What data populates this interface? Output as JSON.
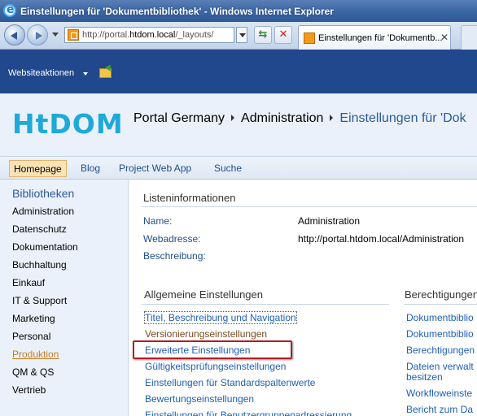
{
  "browser": {
    "window_title": "Einstellungen für 'Dokumentbibliothek' - Windows Internet Explorer",
    "address_host_prefix": "http://portal.",
    "address_host_bold": "htdom.local",
    "address_path": "/_layouts/",
    "tab_title": "Einstellungen für 'Dokumentb...",
    "tab_close": "✕",
    "refresh_glyph": "⇆",
    "stop_glyph": "✕"
  },
  "ribbon": {
    "site_actions": "Websiteaktionen"
  },
  "header": {
    "logo": "HtDOM",
    "breadcrumb": [
      "Portal Germany",
      "Administration",
      "Einstellungen für 'Dok"
    ]
  },
  "topnav": [
    {
      "label": "Homepage",
      "active": true
    },
    {
      "label": "Blog"
    },
    {
      "label": "Project Web App"
    },
    {
      "label": "Suche"
    }
  ],
  "leftnav": {
    "heading": "Bibliotheken",
    "items": [
      "Administration",
      "Datenschutz",
      "Dokumentation",
      "Buchhaltung",
      "Einkauf",
      "IT & Support",
      "Marketing",
      "Personal",
      "Produktion",
      "QM & QS",
      "Vertrieb"
    ],
    "selected": "Produktion"
  },
  "list_info": {
    "title": "Listeninformationen",
    "fields": [
      {
        "label": "Name:",
        "value": "Administration"
      },
      {
        "label": "Webadresse:",
        "value": "http://portal.htdom.local/Administration"
      },
      {
        "label": "Beschreibung:",
        "value": ""
      }
    ]
  },
  "general_settings": {
    "title": "Allgemeine Einstellungen",
    "links": [
      "Titel, Beschreibung und Navigation",
      "Versionierungseinstellungen",
      "Erweiterte Einstellungen",
      "Gültigkeitsprüfungseinstellungen",
      "Einstellungen für Standardspaltenwerte",
      "Bewertungseinstellungen",
      "Einstellungen für Benutzergruppenadressierung"
    ]
  },
  "permissions": {
    "title": "Berechtigungen",
    "links": [
      "Dokumentbiblio",
      "Dokumentbiblio",
      "Berechtigungen",
      "Dateien verwalt",
      "besitzen",
      "Workfloweinste",
      "Bericht zum Da"
    ]
  },
  "colors": {
    "titlebar": "#3f6aa7",
    "ribbon": "#21478c",
    "header_bg": "#eaf1fb",
    "link": "#1f5fb8",
    "highlight_box": "#b01f24"
  }
}
